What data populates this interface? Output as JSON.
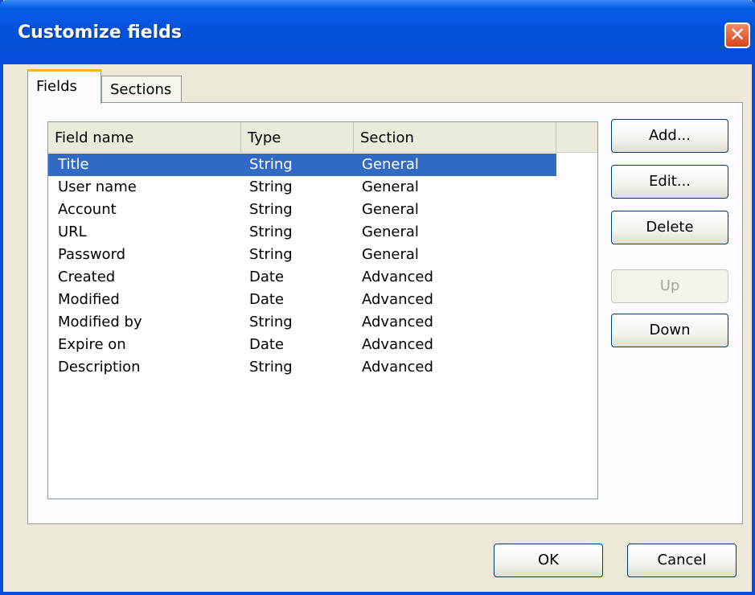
{
  "window": {
    "title": "Customize fields",
    "close_glyph": "✕"
  },
  "tabs": [
    {
      "label": "Fields",
      "active": true
    },
    {
      "label": "Sections",
      "active": false
    }
  ],
  "list": {
    "columns": [
      "Field name",
      "Type",
      "Section"
    ],
    "rows": [
      {
        "name": "Title",
        "type": "String",
        "section": "General",
        "selected": true
      },
      {
        "name": "User name",
        "type": "String",
        "section": "General"
      },
      {
        "name": "Account",
        "type": "String",
        "section": "General"
      },
      {
        "name": "URL",
        "type": "String",
        "section": "General"
      },
      {
        "name": "Password",
        "type": "String",
        "section": "General"
      },
      {
        "name": "Created",
        "type": "Date",
        "section": "Advanced"
      },
      {
        "name": "Modified",
        "type": "Date",
        "section": "Advanced"
      },
      {
        "name": "Modified by",
        "type": "String",
        "section": "Advanced"
      },
      {
        "name": "Expire on",
        "type": "Date",
        "section": "Advanced"
      },
      {
        "name": "Description",
        "type": "String",
        "section": "Advanced"
      }
    ]
  },
  "side_buttons": {
    "add": "Add...",
    "edit": "Edit...",
    "delete": "Delete",
    "up": "Up",
    "down": "Down"
  },
  "footer": {
    "ok": "OK",
    "cancel": "Cancel"
  },
  "colors": {
    "title_bar": "#0553dd",
    "selection": "#316ac5",
    "dialog_background": "#ece9d8",
    "active_tab_accent": "#f9b13a",
    "close_button": "#d9431c"
  }
}
